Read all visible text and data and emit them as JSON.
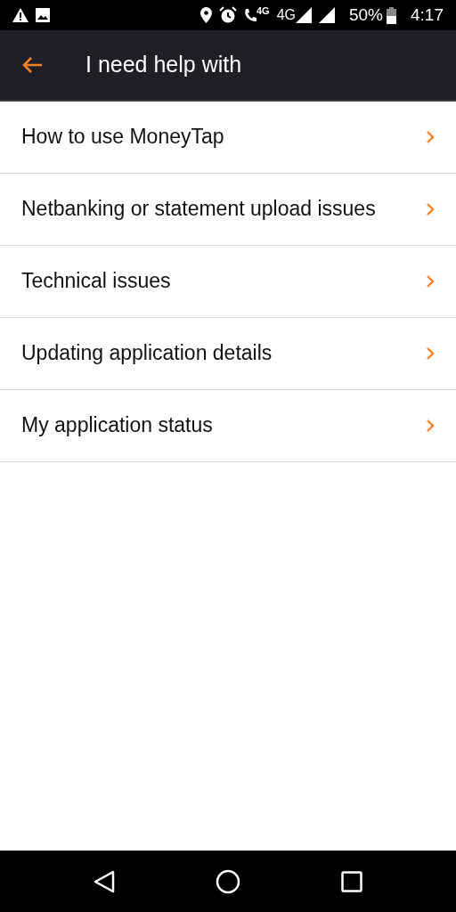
{
  "status_bar": {
    "volte_label": "4G",
    "network_label": "4G",
    "battery": "50%",
    "time": "4:17"
  },
  "app_bar": {
    "title": "I need help with"
  },
  "topics": [
    {
      "label": "How to use MoneyTap"
    },
    {
      "label": "Netbanking or statement upload issues"
    },
    {
      "label": "Technical issues"
    },
    {
      "label": "Updating application details"
    },
    {
      "label": "My application status"
    }
  ]
}
